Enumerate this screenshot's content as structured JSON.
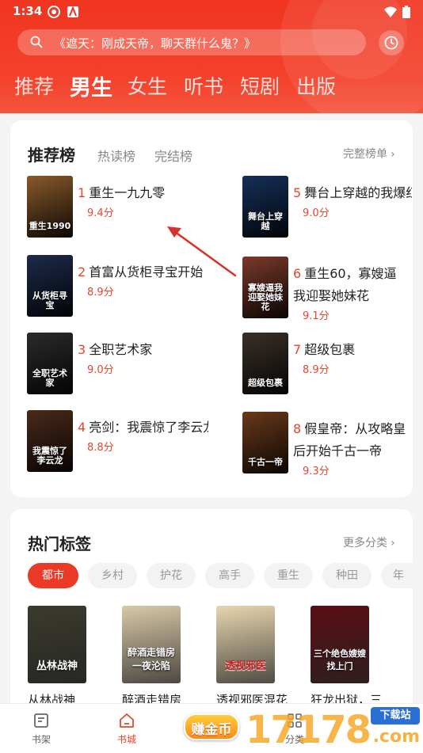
{
  "status": {
    "time": "1:34"
  },
  "search": {
    "placeholder": "《遮天：刚成天帝，聊天群什么鬼？》"
  },
  "nav_tabs": [
    {
      "label": "推荐",
      "active": false
    },
    {
      "label": "男生",
      "active": true
    },
    {
      "label": "女生",
      "active": false
    },
    {
      "label": "听书",
      "active": false
    },
    {
      "label": "短剧",
      "active": false
    },
    {
      "label": "出版",
      "active": false
    }
  ],
  "ranking": {
    "title": "推荐榜",
    "subtabs": [
      "热读榜",
      "完结榜"
    ],
    "more": "完整榜单",
    "books": [
      {
        "rank": "1",
        "title": "重生一九九零",
        "score": "9.4分",
        "cover_text": "重生1990",
        "cover_color": "#8a5a2a"
      },
      {
        "rank": "2",
        "title": "首富从货柜寻宝开始",
        "score": "8.9分",
        "cover_text": "从货柜寻宝",
        "cover_color": "#1d2a4a"
      },
      {
        "rank": "3",
        "title": "全职艺术家",
        "score": "9.0分",
        "cover_text": "全职艺术家",
        "cover_color": "#2b2b2b"
      },
      {
        "rank": "4",
        "title": "亮剑：我震惊了李云龙",
        "score": "8.8分",
        "cover_text": "我震惊了李云龙",
        "cover_color": "#4a2a1a"
      },
      {
        "rank": "5",
        "title": "舞台上穿越的我爆红",
        "score": "9.0分",
        "cover_text": "舞台上穿越",
        "cover_color": "#15305a"
      },
      {
        "rank": "6",
        "title": "重生60，寡嫂逼我迎娶她妹花",
        "score": "9.1分",
        "cover_text": "寡嫂逼我迎娶她妹花",
        "cover_color": "#7a3a2a"
      },
      {
        "rank": "7",
        "title": "超级包裹",
        "score": "8.9分",
        "cover_text": "超级包裹",
        "cover_color": "#3a3128"
      },
      {
        "rank": "8",
        "title": "假皇帝：从攻略皇后开始千古一帝",
        "score": "9.3分",
        "cover_text": "千古一帝",
        "cover_color": "#6a3a1a"
      }
    ]
  },
  "tags_section": {
    "title": "热门标签",
    "more": "更多分类",
    "tags": [
      {
        "label": "都市",
        "active": true
      },
      {
        "label": "乡村",
        "active": false
      },
      {
        "label": "护花",
        "active": false
      },
      {
        "label": "高手",
        "active": false
      },
      {
        "label": "重生",
        "active": false
      },
      {
        "label": "种田",
        "active": false
      },
      {
        "label": "年",
        "active": false
      }
    ],
    "books": [
      {
        "title": "从林战神",
        "cover_text": "丛林战神",
        "cover_color": "#3a3a2e"
      },
      {
        "title": "醉酒走错房",
        "cover_text": "醉酒走错房 一夜沦陷",
        "cover_color": "#d9c9a8"
      },
      {
        "title": "透视邪医混花",
        "cover_text": "透视邪医",
        "cover_color": "#e8d6b0"
      },
      {
        "title": "狂龙出狱，三",
        "cover_text": "三个绝色嫂嫂找上门",
        "cover_color": "#5a0f14"
      }
    ]
  },
  "bottom_nav": {
    "items": [
      {
        "label": "书架",
        "active": false
      },
      {
        "label": "书城",
        "active": true
      },
      {
        "label": "赚金币",
        "active": false
      },
      {
        "label": "分类",
        "active": false
      }
    ]
  },
  "watermark": {
    "digits": "17178",
    "badge": "下载站",
    "suffix": ".com"
  }
}
